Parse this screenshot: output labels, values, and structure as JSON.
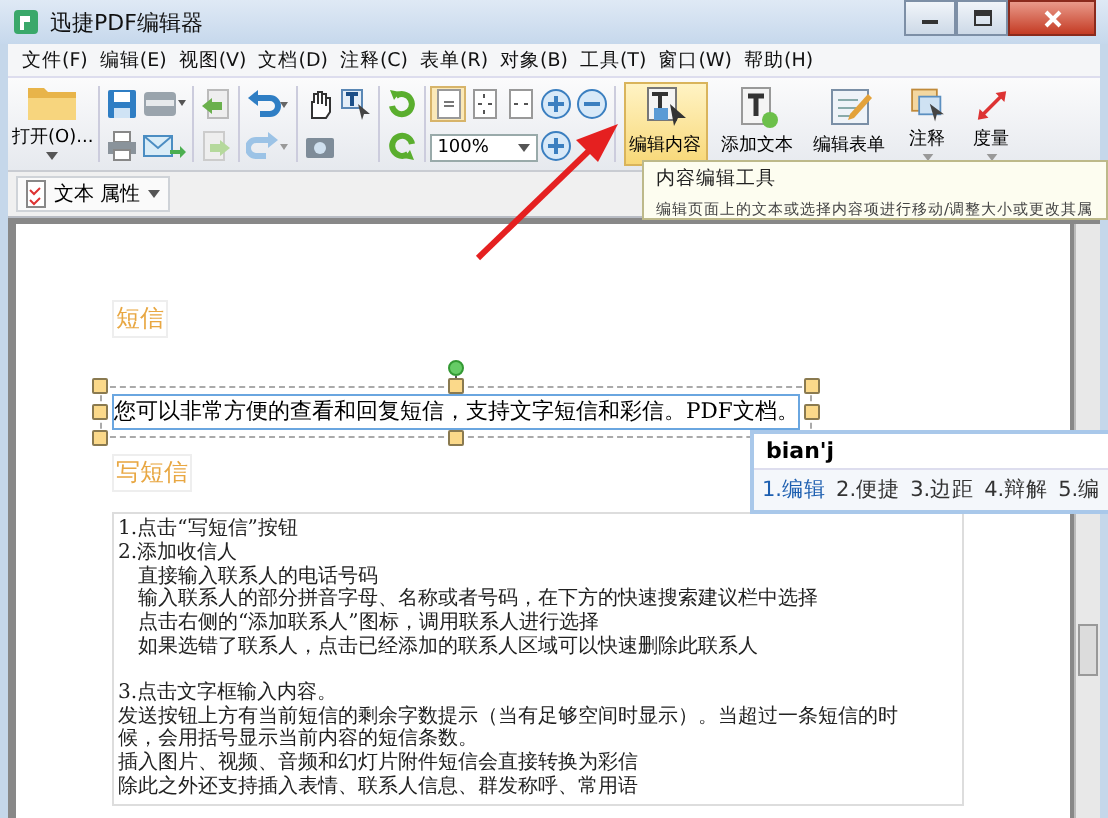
{
  "window": {
    "title": "迅捷PDF编辑器"
  },
  "menu": [
    "文件(F)",
    "编辑(E)",
    "视图(V)",
    "文档(D)",
    "注释(C)",
    "表单(R)",
    "对象(B)",
    "工具(T)",
    "窗口(W)",
    "帮助(H)"
  ],
  "toolbar": {
    "open_button": {
      "label": "打开(O)..."
    },
    "zoom_field": {
      "value": "100%"
    },
    "big_buttons": [
      {
        "kind": "edit-content",
        "label": "编辑内容",
        "selected": true
      },
      {
        "kind": "add-text",
        "label": "添加文本",
        "selected": false
      },
      {
        "kind": "edit-form",
        "label": "编辑表单",
        "selected": false
      },
      {
        "kind": "annotate",
        "label": "注释",
        "selected": false
      },
      {
        "kind": "measure",
        "label": "度量",
        "selected": false
      }
    ]
  },
  "property_bar": {
    "button": {
      "label": "文本 属性"
    }
  },
  "tooltip": {
    "title": "内容编辑工具",
    "description": "编辑页面上的文本或选择内容项进行移动/调整大小或更改其属"
  },
  "document": {
    "heading_1": "短信",
    "selected_text": "您可以非常方便的查看和回复短信，支持文字短信和彩信。PDF文档。",
    "heading_2": "写短信",
    "paragraphs": [
      [
        {
          "text": "1.点击“写短信”按钮"
        },
        {
          "text": "2.添加收信人",
          "children": [
            {
              "text": "直接输入联系人的电话号码"
            },
            {
              "text": "输入联系人的部分拼音字母、名称或者号码，在下方的快速搜索建议栏中选择"
            },
            {
              "text": "点击右侧的“添加联系人”图标，调用联系人进行选择"
            },
            {
              "text": "如果选错了联系人，点击已经添加的联系人区域可以快速删除此联系人"
            }
          ]
        }
      ],
      [
        {
          "text": "3.点击文字框输入内容。"
        },
        {
          "text": "发送按钮上方有当前短信的剩余字数提示（当有足够空间时显示）。当超过一条短信的时"
        },
        {
          "text": "候，会用括号显示当前内容的短信条数。"
        },
        {
          "text": "插入图片、视频、音频和幻灯片附件短信会直接转换为彩信"
        },
        {
          "text": "除此之外还支持插入表情、联系人信息、群发称呼、常用语"
        }
      ]
    ]
  },
  "ime": {
    "input": "bian'j",
    "candidates": [
      {
        "label": "1.编辑",
        "selected": true
      },
      {
        "label": "2.便捷",
        "selected": false
      },
      {
        "label": "3.边距",
        "selected": false
      },
      {
        "label": "4.辩解",
        "selected": false
      },
      {
        "label": "5.编",
        "selected": false
      }
    ]
  }
}
